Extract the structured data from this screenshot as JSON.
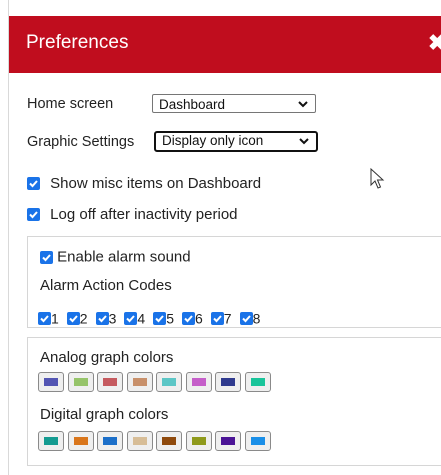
{
  "dialog": {
    "title": "Preferences",
    "close_glyph": "✖"
  },
  "home_screen": {
    "label": "Home screen",
    "value": "Dashboard"
  },
  "graphic_settings": {
    "label": "Graphic Settings",
    "value": "Display only icon"
  },
  "options": {
    "show_misc": {
      "label": "Show misc items on Dashboard",
      "checked": true
    },
    "log_off": {
      "label": "Log off after inactivity period",
      "checked": true
    }
  },
  "alarm": {
    "enable_label": "Enable alarm sound",
    "enabled": true,
    "codes_label": "Alarm Action Codes",
    "codes": [
      "1",
      "2",
      "3",
      "4",
      "5",
      "6",
      "7",
      "8"
    ]
  },
  "graph_colors": {
    "analog_label": "Analog graph colors",
    "analog": [
      "#5355b3",
      "#96c46a",
      "#c55a5f",
      "#c8906a",
      "#5cc6c6",
      "#c55ec9",
      "#2f3a8e",
      "#19c49a"
    ],
    "digital_label": "Digital graph colors",
    "digital": [
      "#149b91",
      "#d9761c",
      "#1c6fc9",
      "#d7bd97",
      "#8f4a0d",
      "#8f9a1c",
      "#4b1496",
      "#1a8fe8"
    ]
  },
  "colors": {
    "header": "#c00d1e",
    "checkbox": "#1a73e8"
  }
}
